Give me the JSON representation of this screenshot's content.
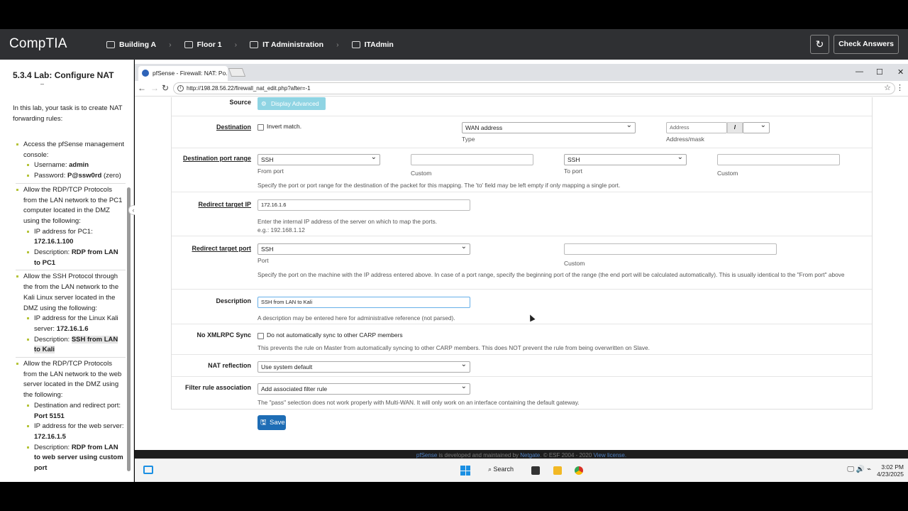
{
  "topbar": {
    "logo": "CompTIA",
    "crumbs": [
      "Building A",
      "Floor 1",
      "IT Administration",
      "ITAdmin"
    ],
    "reset_icon": "refresh-icon",
    "check_answers": "Check Answers"
  },
  "sidebar": {
    "title": "5.3.4 Lab: Configure NAT",
    "intro": "In this lab, your task is to create NAT forwarding rules:",
    "items": [
      {
        "text": "Access the pfSense management console:",
        "subs": [
          {
            "label": "Username: ",
            "value": "admin"
          },
          {
            "label": "Password: ",
            "value": "P@ssw0rd",
            "suffix": " (zero)"
          }
        ]
      },
      {
        "text": "Allow the RDP/TCP Protocols from the LAN network to the PC1 computer located in the DMZ using the following:",
        "subs": [
          {
            "label": "IP address for PC1: ",
            "value": "172.16.1.100"
          },
          {
            "label": "Description: ",
            "value": "RDP from LAN to PC1"
          }
        ]
      },
      {
        "text": "Allow the SSH Protocol through the from the LAN network to the Kali Linux server located in the DMZ using the following:",
        "subs": [
          {
            "label": "IP address for the Linux Kali server: ",
            "value": "172.16.1.6"
          },
          {
            "label": "Description: ",
            "value": "SSH from LAN to Kali",
            "highlight": true
          }
        ]
      },
      {
        "text": "Allow the RDP/TCP Protocols from the LAN network to the web server located in the DMZ using the following:",
        "subs": [
          {
            "label": "Destination and redirect port: ",
            "value": "Port 5151"
          },
          {
            "label": "IP address for the web server: ",
            "value": "172.16.1.5"
          },
          {
            "label": "Description: ",
            "value": "RDP from LAN to web server using custom port"
          }
        ]
      }
    ]
  },
  "browser": {
    "tab_title": "pfSense - Firewall: NAT: Po...",
    "url": "http://198.28.56.22/firewall_nat_edit.php?after=-1"
  },
  "form": {
    "source_label": "Source",
    "display_advanced": "Display Advanced",
    "destination_label": "Destination",
    "invert_match": "Invert match.",
    "dest_type_value": "WAN address",
    "dest_type_caption": "Type",
    "address_placeholder": "Address",
    "slash": "/",
    "address_mask_caption": "Address/mask",
    "dest_port_range_label": "Destination port range",
    "from_port_value": "SSH",
    "from_port_caption": "From port",
    "custom_caption": "Custom",
    "to_port_value": "SSH",
    "to_port_caption": "To port",
    "port_range_help": "Specify the port or port range for the destination of the packet for this mapping. The 'to' field may be left empty if only mapping a single port.",
    "redirect_ip_label": "Redirect target IP",
    "redirect_ip_value": "172.16.1.6",
    "redirect_ip_help1": "Enter the internal IP address of the server on which to map the ports.",
    "redirect_ip_help2": "e.g.: 192.168.1.12",
    "redirect_port_label": "Redirect target port",
    "redirect_port_value": "SSH",
    "port_caption": "Port",
    "redirect_port_help": "Specify the port on the machine with the IP address entered above. In case of a port range, specify the beginning port of the range (the end port will be calculated automatically). This is usually identical to the \"From port\" above",
    "description_label": "Description",
    "description_value": "SSH from LAN to Kali",
    "description_help": "A description may be entered here for administrative reference (not parsed).",
    "xmlrpc_label": "No XMLRPC Sync",
    "xmlrpc_check": "Do not automatically sync to other CARP members",
    "xmlrpc_help": "This prevents the rule on Master from automatically syncing to other CARP members. This does NOT prevent the rule from being overwritten on Slave.",
    "nat_reflection_label": "NAT reflection",
    "nat_reflection_value": "Use system default",
    "filter_rule_label": "Filter rule association",
    "filter_rule_value": "Add associated filter rule",
    "filter_rule_help": "The \"pass\" selection does not work properly with Multi-WAN. It will only work on an interface containing the default gateway.",
    "save": "Save"
  },
  "footer": {
    "pfsense": "pfSense",
    "mid": " is developed and maintained by ",
    "netgate": "Netgate",
    "copy": ". © ESF 2004 - 2020 ",
    "license": "View license."
  },
  "taskbar": {
    "search": "Search",
    "time": "3:02 PM",
    "date": "4/23/2025"
  }
}
